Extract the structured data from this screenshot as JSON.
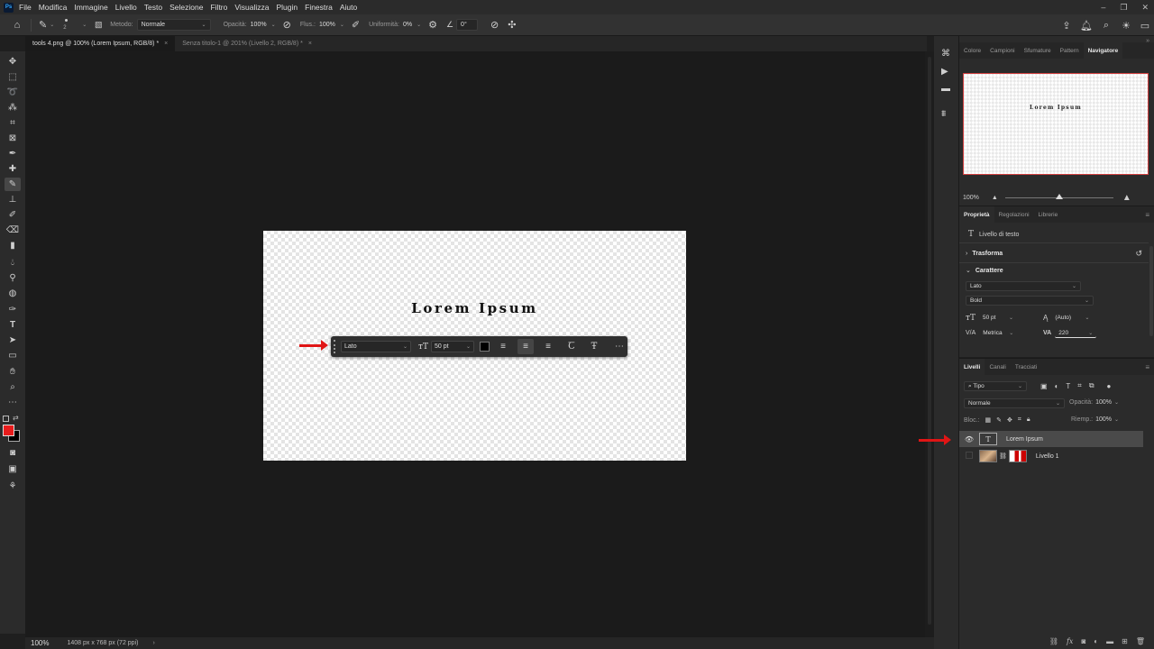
{
  "app": {
    "logo": "Ps"
  },
  "menu": [
    "File",
    "Modifica",
    "Immagine",
    "Livello",
    "Testo",
    "Selezione",
    "Filtro",
    "Visualizza",
    "Plugin",
    "Finestra",
    "Aiuto"
  ],
  "options": {
    "brush_size": "2",
    "metodo_label": "Metodo:",
    "metodo_value": "Normale",
    "opacita_label": "Opacità:",
    "opacita_value": "100%",
    "flusso_label": "Flus.:",
    "flusso_value": "100%",
    "uniformita_label": "Uniformità:",
    "uniformita_value": "0%",
    "angle_value": "0°"
  },
  "tabs": [
    {
      "label": "tools 4.png @ 100% (Lorem Ipsum, RGB/8) *",
      "active": true
    },
    {
      "label": "Senza titolo-1 @ 201% (Livello 2, RGB/8) *",
      "active": false
    }
  ],
  "canvas": {
    "text": "Lorem Ipsum"
  },
  "context_bar": {
    "font": "Lato",
    "size": "50 pt"
  },
  "status": {
    "zoom": "100%",
    "info": "1408 px x 768 px (72 ppi)"
  },
  "navigator": {
    "tabs": [
      "Colore",
      "Campioni",
      "Sfumature",
      "Pattern",
      "Navigatore"
    ],
    "active_tab": "Navigatore",
    "zoom": "100%"
  },
  "properties": {
    "tabs": [
      "Proprietà",
      "Regolazioni",
      "Librerie"
    ],
    "layer_type": "Livello di testo",
    "trasforma": "Trasforma",
    "carattere": "Carattere",
    "font_family": "Lato",
    "font_style": "Bold",
    "font_size": "50 pt",
    "leading": "(Auto)",
    "kerning": "Metrica",
    "tracking": "220"
  },
  "layers": {
    "tabs": [
      "Livelli",
      "Canali",
      "Tracciati"
    ],
    "filter": "Tipo",
    "blend": "Normale",
    "opacity_label": "Opacità:",
    "opacity_value": "100%",
    "lock_label": "Bloc.:",
    "fill_label": "Riemp.:",
    "fill_value": "100%",
    "items": [
      {
        "name": "Lorem Ipsum",
        "type": "text",
        "visible": true,
        "selected": true
      },
      {
        "name": "Livello 1",
        "type": "image",
        "visible": false,
        "selected": false
      }
    ]
  },
  "colors": {
    "accent_red": "#e01515",
    "foreground": "#e81c1c",
    "background": "#000000"
  }
}
